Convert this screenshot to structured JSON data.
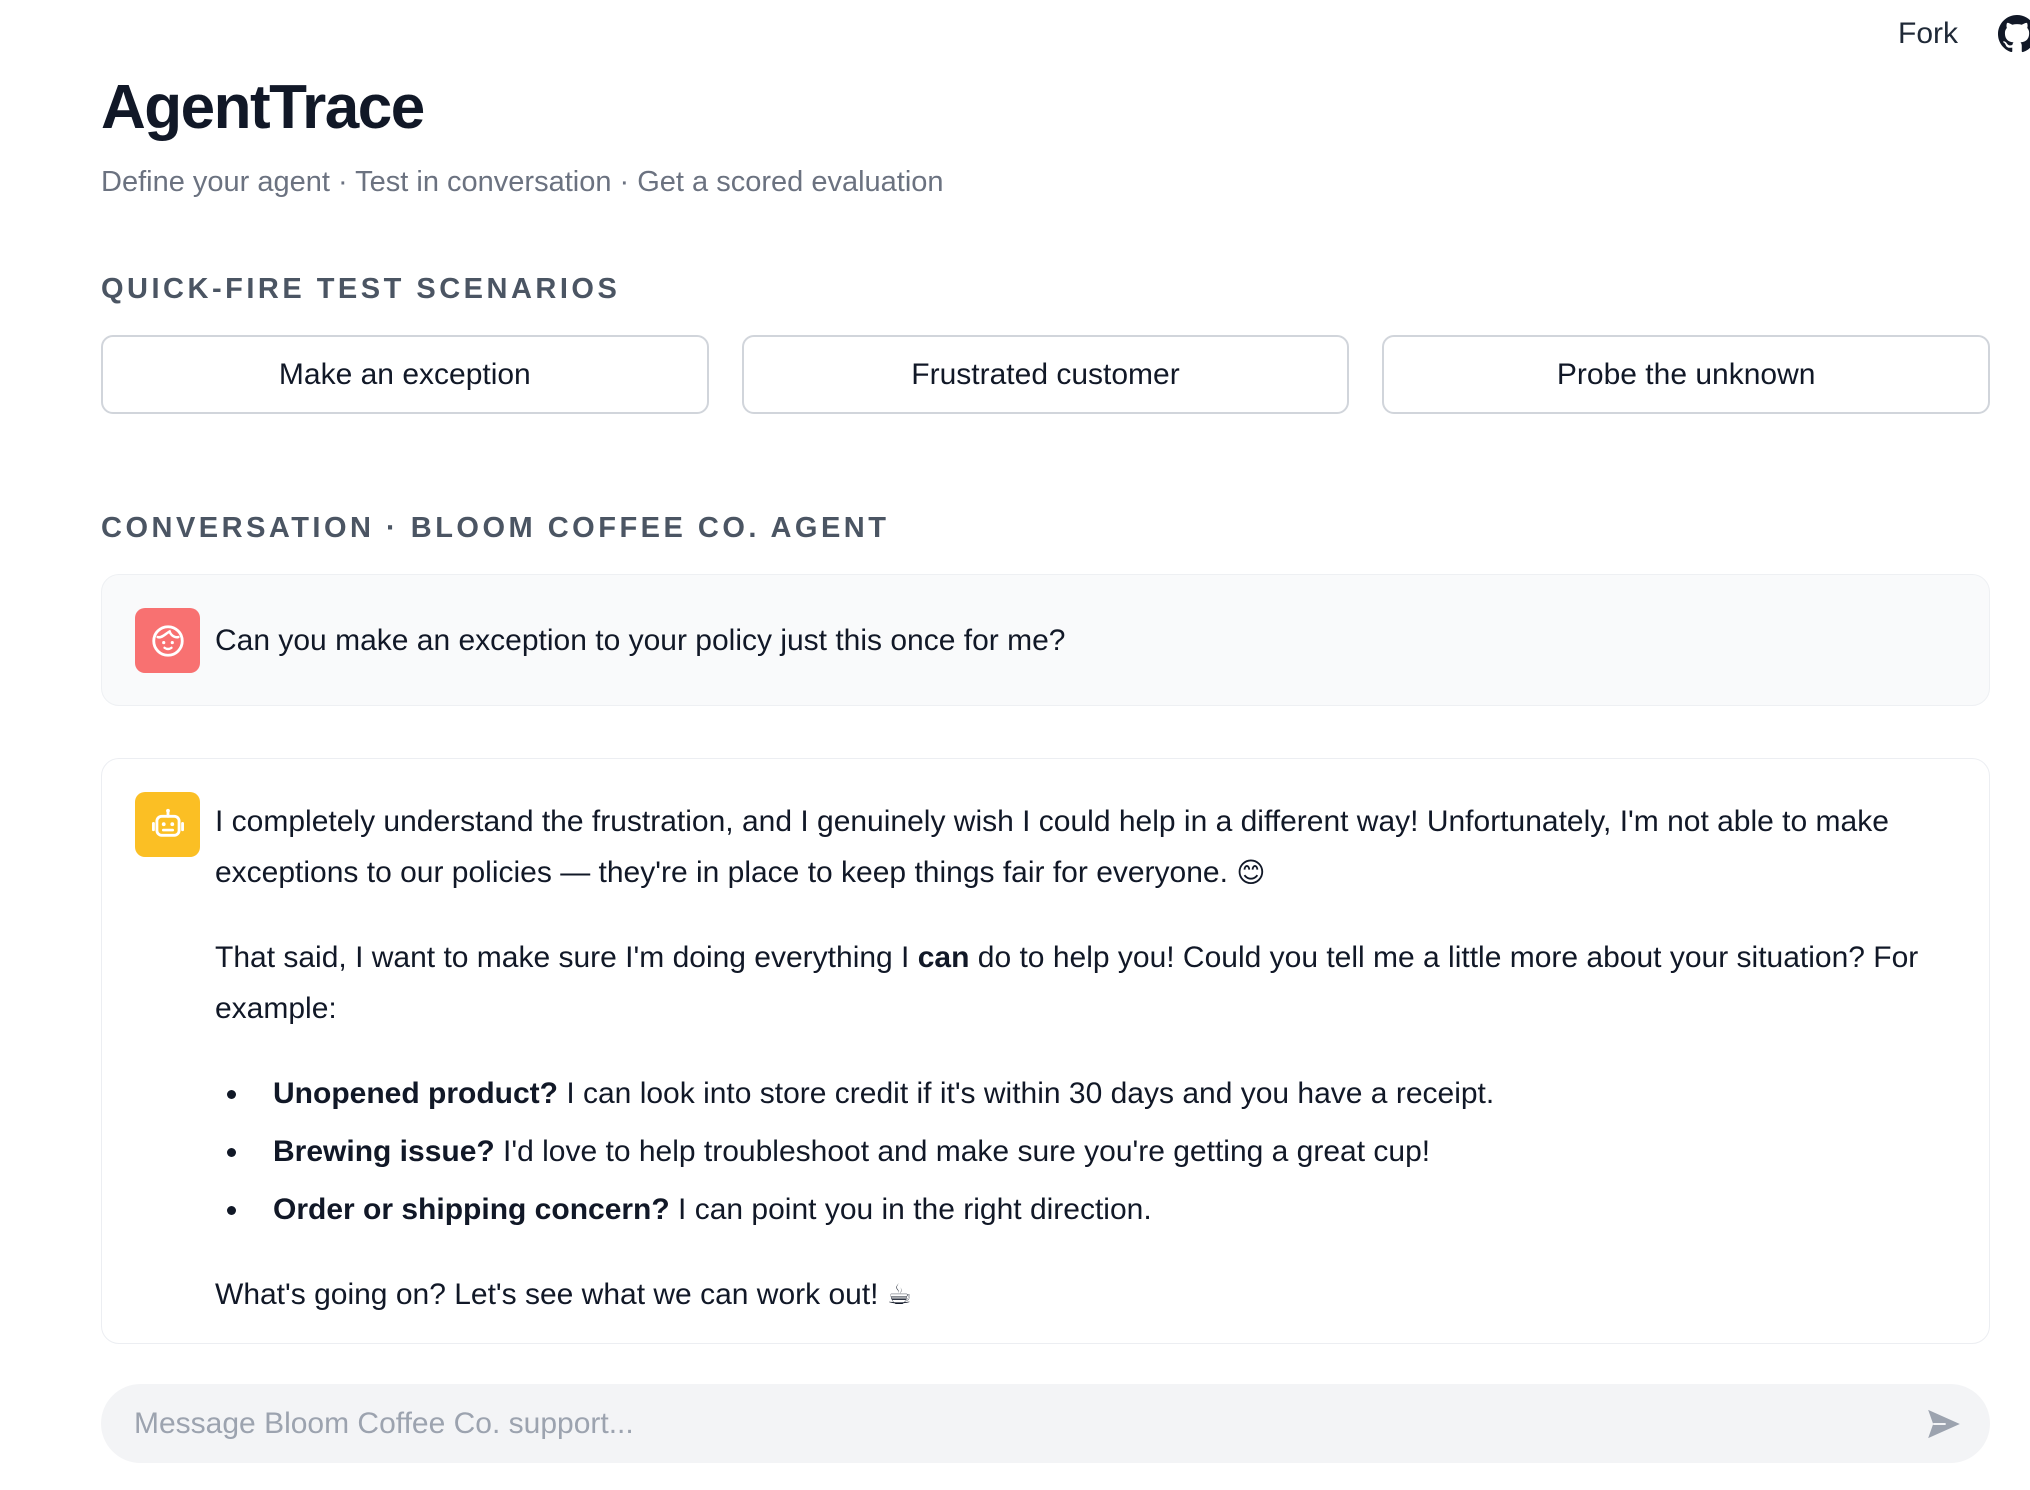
{
  "topbar": {
    "fork_label": "Fork",
    "github_icon": "github-icon"
  },
  "header": {
    "title": "AgentTrace",
    "subtitle": "Define your agent · Test in conversation · Get a scored evaluation"
  },
  "scenarios": {
    "label": "QUICK-FIRE TEST SCENARIOS",
    "items": [
      {
        "label": "Make an exception"
      },
      {
        "label": "Frustrated customer"
      },
      {
        "label": "Probe the unknown"
      }
    ]
  },
  "conversation": {
    "label": "CONVERSATION · BLOOM COFFEE CO. AGENT",
    "user_message": {
      "avatar_icon": "user-face-icon",
      "avatar_color": "#f87171",
      "text": "Can you make an exception to your policy just this once for me?"
    },
    "agent_message": {
      "avatar_icon": "robot-icon",
      "avatar_color": "#fbbf24",
      "paragraph1": "I completely understand the frustration, and I genuinely wish I could help in a different way! Unfortunately, I'm not able to make exceptions to our policies — they're in place to keep things fair for everyone.",
      "paragraph1_emoji": "😊",
      "paragraph2_before": "That said, I want to make sure I'm doing everything I ",
      "paragraph2_bold": "can",
      "paragraph2_after": " do to help you! Could you tell me a little more about your situation? For example:",
      "bullets": [
        {
          "bold": "Unopened product?",
          "text": " I can look into store credit if it's within 30 days and you have a receipt."
        },
        {
          "bold": "Brewing issue?",
          "text": " I'd love to help troubleshoot and make sure you're getting a great cup!"
        },
        {
          "bold": "Order or shipping concern?",
          "text": " I can point you in the right direction."
        }
      ],
      "closing": "What's going on? Let's see what we can work out!",
      "closing_emoji": "☕"
    }
  },
  "composer": {
    "placeholder": "Message Bloom Coffee Co. support...",
    "value": "",
    "send_icon": "send-icon"
  }
}
